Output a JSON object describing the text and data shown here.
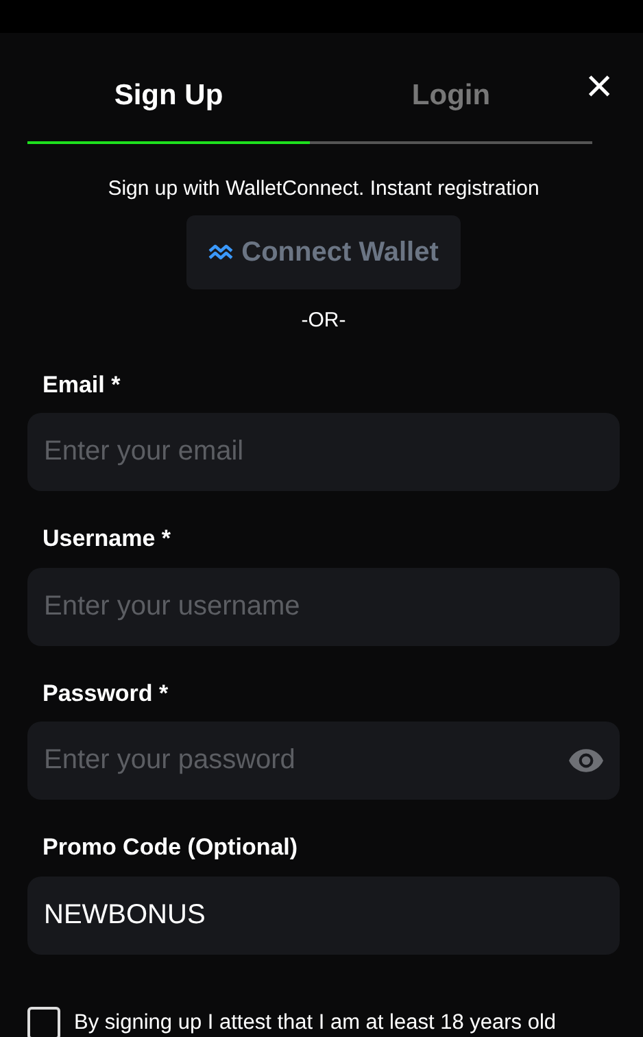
{
  "tabs": [
    {
      "label": "Sign Up",
      "selected": true
    },
    {
      "label": "Login",
      "selected": false
    }
  ],
  "close": "×",
  "wallet_prompt": "Sign up with WalletConnect. Instant registration",
  "wallet_button": "Connect Wallet",
  "divider": "-OR-",
  "fields": [
    {
      "label": "Email *",
      "placeholder": "Enter your email",
      "kind": "text"
    },
    {
      "label": "Username *",
      "placeholder": "Enter your username",
      "kind": "text"
    },
    {
      "label": "Password *",
      "placeholder": "Enter your password",
      "kind": "password"
    },
    {
      "label": "Promo Code (Optional)",
      "value": "NEWBONUS",
      "kind": "text"
    }
  ],
  "agreement": {
    "label": "By signing up I attest that I am at least 18 years old",
    "checked": false
  }
}
